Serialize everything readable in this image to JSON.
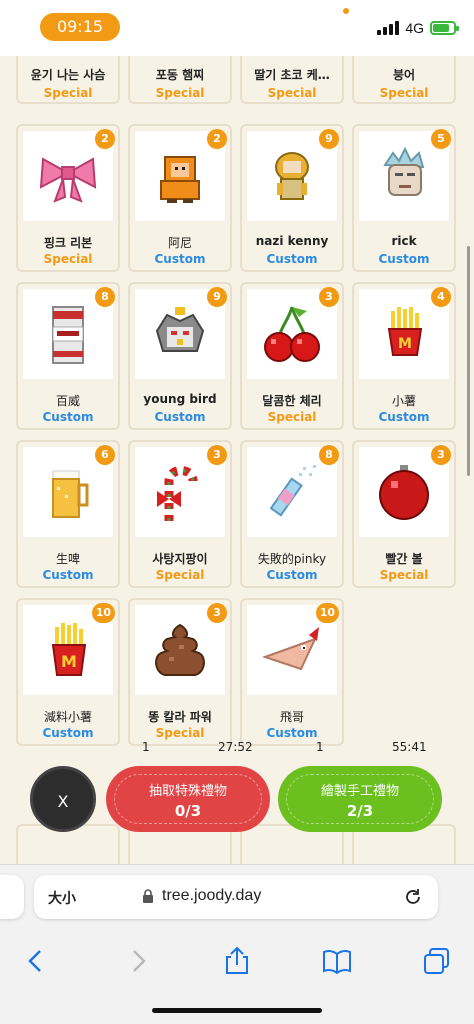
{
  "status": {
    "time": "09:15",
    "network": "4G"
  },
  "row0": [
    {
      "name": "윤기 나는 사슴",
      "tag": "Special"
    },
    {
      "name": "포동 햄찌",
      "tag": "Special"
    },
    {
      "name": "딸기 초코 케…",
      "tag": "Special"
    },
    {
      "name": "붕어",
      "tag": "Special"
    }
  ],
  "cards": [
    {
      "name": "핑크 리본",
      "tag": "Special",
      "count": "2",
      "icon": "pink-ribbon-icon"
    },
    {
      "name": "阿尼",
      "tag": "Custom",
      "count": "2",
      "icon": "orange-hood-character-icon"
    },
    {
      "name": "nazi kenny",
      "tag": "Custom",
      "count": "9",
      "icon": "kenny-character-icon"
    },
    {
      "name": "rick",
      "tag": "Custom",
      "count": "5",
      "icon": "rick-head-icon"
    },
    {
      "name": "百威",
      "tag": "Custom",
      "count": "8",
      "icon": "beer-can-icon"
    },
    {
      "name": "young bird",
      "tag": "Custom",
      "count": "9",
      "icon": "bird-character-icon"
    },
    {
      "name": "달콤한 체리",
      "tag": "Special",
      "count": "3",
      "icon": "cherry-icon"
    },
    {
      "name": "小薯",
      "tag": "Custom",
      "count": "4",
      "icon": "fries-icon"
    },
    {
      "name": "生啤",
      "tag": "Custom",
      "count": "6",
      "icon": "beer-mug-icon"
    },
    {
      "name": "사탕지팡이",
      "tag": "Special",
      "count": "3",
      "icon": "candy-cane-icon"
    },
    {
      "name": "失敗的pinky",
      "tag": "Custom",
      "count": "8",
      "icon": "pinky-bottle-icon"
    },
    {
      "name": "빨간 볼",
      "tag": "Special",
      "count": "3",
      "icon": "red-ornament-icon"
    },
    {
      "name": "減料小薯",
      "tag": "Custom",
      "count": "10",
      "icon": "fries-icon"
    },
    {
      "name": "똥 칼라 파워",
      "tag": "Special",
      "count": "3",
      "icon": "poop-icon"
    },
    {
      "name": "飛哥",
      "tag": "Custom",
      "count": "10",
      "icon": "phineas-head-icon"
    }
  ],
  "timers": {
    "left_prefix": "1",
    "left_time": "27:52",
    "right_prefix": "1",
    "right_time": "55:41"
  },
  "actions": {
    "close_label": "X",
    "special_label": "抽取特殊禮物",
    "special_count": "0/3",
    "custom_label": "繪製手工禮物",
    "custom_count": "2/3"
  },
  "browser": {
    "text_size_label": "大小",
    "host": "tree.joody.day"
  },
  "colors": {
    "special": "#f39a14",
    "custom": "#2b8be0",
    "red_button": "#e14444",
    "green_button": "#6bbf1f"
  }
}
